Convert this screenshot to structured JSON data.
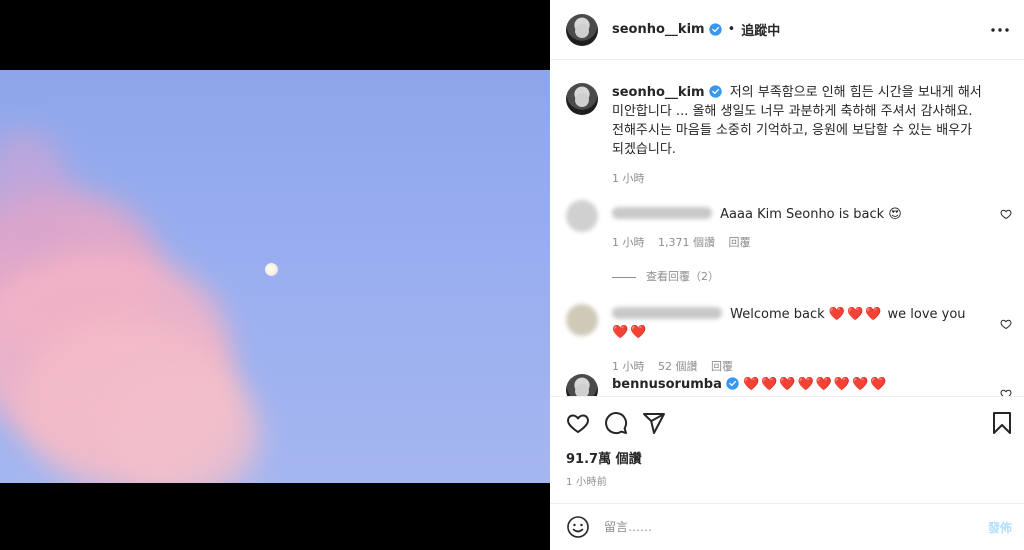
{
  "media": {
    "description_colors": {
      "sky": "#99aef0",
      "cloud": "#f0b0c8"
    }
  },
  "header": {
    "username": "seonho__kim",
    "separator": "•",
    "follow_status": "追蹤中",
    "more_icon": "more-horizontal-icon"
  },
  "caption": {
    "username": "seonho__kim",
    "text": "저의 부족함으로 인해 힘든 시간을 보내게 해서 미안합니다 ... 올해 생일도 너무 과분하게 축하해 주셔서 감사해요. 전해주시는 마음들 소중히 기억하고, 응원에 보답할 수 있는 배우가 되겠습니다.",
    "time": "1 小時"
  },
  "comments": [
    {
      "text": "Aaaa Kim Seonho is back 😍",
      "time": "1 小時",
      "likes": "1,371 個讚",
      "reply": "回覆",
      "view_replies": "查看回覆（2）"
    },
    {
      "text_parts": [
        "Welcome back",
        "❤️❤️❤️",
        "we love you",
        "❤️❤️"
      ],
      "time": "1 小時",
      "likes": "52 個讚",
      "reply": "回覆"
    },
    {
      "username": "bennusorumba",
      "hearts": "❤️❤️❤️❤️❤️❤️❤️❤️"
    }
  ],
  "stats": {
    "likes": "91.7萬 個讚",
    "time": "1 小時前"
  },
  "composer": {
    "placeholder": "留言……",
    "post_label": "發佈"
  },
  "colors": {
    "verified": "#3897f0",
    "heart": "#e0245e",
    "post_disabled": "#b2dffc"
  }
}
